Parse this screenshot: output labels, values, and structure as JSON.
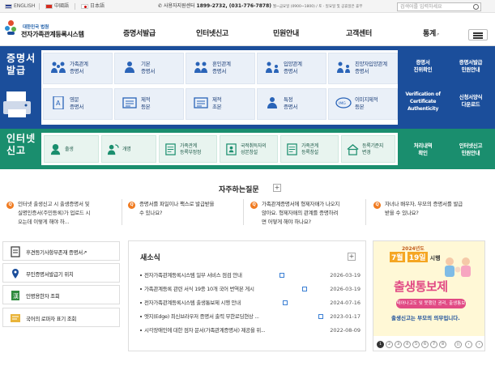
{
  "topbar": {
    "languages": [
      "ENGLISH",
      "中國語",
      "日本語"
    ],
    "tel_label": "사용자지원센터",
    "tel_numbers": "1899-2732, (031-776-7878)",
    "tel_hours": "월~금요일 (0900~1800) / 토 · 일요일 및 공휴일은 휴무",
    "search_placeholder": "검색어를 입력하세요"
  },
  "header": {
    "logo_sub": "대한민국 법원",
    "logo_title": "전자가족관계등록시스템",
    "menu": [
      "증명서발급",
      "인터넷신고",
      "민원안내",
      "고객센터",
      "통계"
    ],
    "external_mark": "↗"
  },
  "cert": {
    "section_label": [
      "증명서",
      "발급"
    ],
    "items": [
      {
        "label": [
          "가족관계",
          "증명서"
        ],
        "highlight": true,
        "icon": "family-icon"
      },
      {
        "label": [
          "기본",
          "증명서"
        ],
        "highlight": false,
        "icon": "person-icon"
      },
      {
        "label": [
          "혼인관계",
          "증명서"
        ],
        "highlight": false,
        "icon": "couple-icon"
      },
      {
        "label": [
          "입양관계",
          "증명서"
        ],
        "highlight": false,
        "icon": "adoption-icon"
      },
      {
        "label": [
          "친양자입양관계",
          "증명서"
        ],
        "highlight": false,
        "icon": "parent-child-icon"
      },
      {
        "label": [
          "영문",
          "증명서"
        ],
        "highlight": false,
        "icon": "english-doc-icon"
      },
      {
        "label": [
          "제적",
          "등본"
        ],
        "highlight": false,
        "icon": "register-copy-icon"
      },
      {
        "label": [
          "제적",
          "초본"
        ],
        "highlight": false,
        "icon": "register-extract-icon"
      },
      {
        "label": [
          "특정",
          "증명서"
        ],
        "highlight": false,
        "icon": "specific-doc-icon"
      },
      {
        "label": [
          "이미지제적",
          "등본"
        ],
        "highlight": false,
        "icon": "image-register-icon"
      }
    ],
    "side_links": [
      [
        "증명서",
        "진위확인"
      ],
      [
        "증명서발급",
        "민원안내"
      ],
      [
        "Verification of",
        "Certificate",
        "Authenticity"
      ],
      [
        "신청서양식",
        "다운로드"
      ]
    ]
  },
  "report": {
    "section_label": [
      "인터넷",
      "신고"
    ],
    "items": [
      {
        "label": [
          "출생"
        ],
        "icon": "baby-icon"
      },
      {
        "label": [
          "개명"
        ],
        "icon": "rename-icon"
      },
      {
        "label": [
          "가족관계",
          "등록부정정"
        ],
        "icon": "correction-icon"
      },
      {
        "label": [
          "국적취득자의",
          "성본창설"
        ],
        "icon": "nationality-icon"
      },
      {
        "label": [
          "가족관계",
          "등록창설"
        ],
        "icon": "registration-icon"
      },
      {
        "label": [
          "등록기준지",
          "변경"
        ],
        "icon": "house-icon"
      }
    ],
    "side_links": [
      [
        "처리내역",
        "확인"
      ],
      [
        "인터넷신고",
        "민원안내"
      ]
    ]
  },
  "faq": {
    "title": "자주하는질문",
    "more": "+",
    "badge": "Q",
    "items": [
      [
        "인터넷 출생신고 시 출생증명서 및",
        "실명인증서(주민등록)가 업로드 시",
        "오는데 이렇게 해야 하..."
      ],
      [
        "증명서를 파일이나 팩스로 발급받을",
        "수 있나요?"
      ],
      [
        "가족관계증명서에 형제자매가 나오지",
        "않아요. 형제자매의 관계를 증명하려",
        "면 어떻게 해야 하나요?"
      ],
      [
        "자녀나 배우자, 부모의 증명서를 발급",
        "받을 수 있나요?"
      ]
    ]
  },
  "quick_links": [
    {
      "label": "후견등기사항부존재 증명서",
      "ext": "↗",
      "icon": "guardian-doc-icon"
    },
    {
      "label": "무인증명서발급기 위치",
      "ext": "",
      "icon": "kiosk-location-icon"
    },
    {
      "label": "인명용한자 조회",
      "ext": "",
      "icon": "hanja-book-icon"
    },
    {
      "label": "국어의 로마자 표기 조회",
      "ext": "",
      "icon": "romanization-icon"
    }
  ],
  "news": {
    "title": "새소식",
    "more": "+",
    "items": [
      {
        "title": "전자가족관계등록시스템 일부 서비스 점검 안내",
        "date": "2026-03-19",
        "is_new": true
      },
      {
        "title": "가족관계등록 관련 서식 19종 10개 국어 번역본 게시",
        "date": "2026-03-19",
        "is_new": true
      },
      {
        "title": "전자가족관계등록시스템 출생통보제 시행 안내",
        "date": "2024-07-16",
        "is_new": true
      },
      {
        "title": "엣지(Edge) 최신브라우저 증명서 출력 무한로딩현상 ...",
        "date": "2023-01-17",
        "is_new": true
      },
      {
        "title": "시각장애인에 대한 점자 문서(가족관계증명서) 제공을 위...",
        "date": "2022-08-09",
        "is_new": false
      }
    ]
  },
  "banner": {
    "top": "2024년도",
    "date_month": "7월",
    "date_day": "19일",
    "date_suffix": "시행",
    "main": "출생통보제",
    "pill": "태어나고도 잊 못했던 권리, 출생통보",
    "sub": "출생신고는 부모의 의무입니다.",
    "pages": [
      "1",
      "2",
      "3",
      "4",
      "5",
      "6",
      "7",
      "8"
    ],
    "active_page": "1",
    "colors": {
      "accent": "#e14a84",
      "brand": "#1b4e9b"
    }
  },
  "colors": {
    "cert_band": "#1b4e9b",
    "report_band": "#1a8e6e",
    "faq_badge": "#f07b21"
  }
}
